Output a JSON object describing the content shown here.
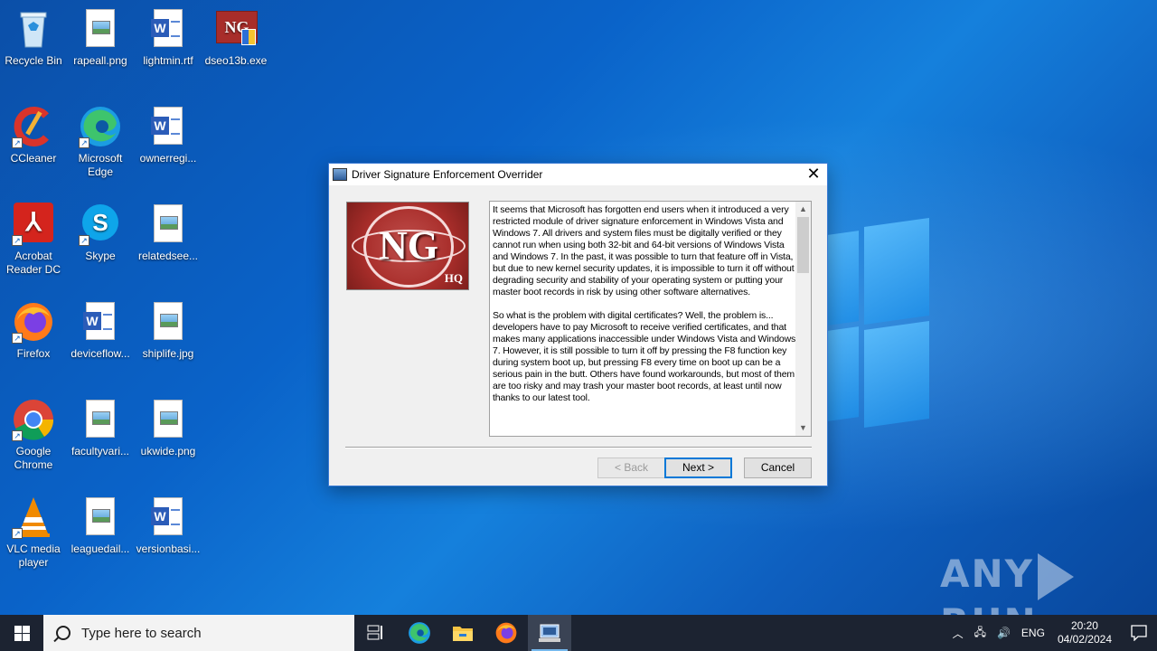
{
  "desktop": {
    "icons": [
      {
        "label": "Recycle Bin"
      },
      {
        "label": "rapeall.png"
      },
      {
        "label": "lightmin.rtf"
      },
      {
        "label": "dseo13b.exe"
      },
      {
        "label": "CCleaner"
      },
      {
        "label": "Microsoft Edge"
      },
      {
        "label": "ownerregi..."
      },
      {
        "label": "Acrobat Reader DC"
      },
      {
        "label": "Skype"
      },
      {
        "label": "relatedsee..."
      },
      {
        "label": "Firefox"
      },
      {
        "label": "deviceflow..."
      },
      {
        "label": "shiplife.jpg"
      },
      {
        "label": "Google Chrome"
      },
      {
        "label": "facultyvari..."
      },
      {
        "label": "ukwide.png"
      },
      {
        "label": "VLC media player"
      },
      {
        "label": "leaguedail..."
      },
      {
        "label": "versionbasi..."
      }
    ]
  },
  "dialog": {
    "title": "Driver Signature Enforcement Overrider",
    "logo": {
      "text": "NG",
      "sub": "HQ"
    },
    "paragraphs": [
      "It seems that Microsoft has forgotten end users when it introduced a very restricted module of driver signature enforcement in Windows Vista and Windows 7. All drivers and system files must be digitally verified or they cannot run when using both 32-bit and 64-bit versions of Windows Vista and Windows 7. In the past, it was possible to turn that feature off in Vista, but due to new kernel security updates, it is impossible to turn it off without degrading security and stability of your operating system or putting your master boot records in risk by using other software alternatives.",
      "So what is the problem with digital certificates? Well, the problem is... developers have to pay Microsoft to receive verified certificates, and that makes many applications inaccessible under Windows Vista and Windows 7. However, it is still possible to turn it off by pressing the F8 function key during system boot up, but pressing F8 every time on boot up can be a serious pain in the butt. Others have found workarounds, but most of them are too risky and may trash your master boot records, at least until now thanks to our latest tool."
    ],
    "buttons": {
      "back": "< Back",
      "next": "Next >",
      "cancel": "Cancel"
    }
  },
  "watermark": {
    "left": "ANY",
    "right": "RUN"
  },
  "taskbar": {
    "search_placeholder": "Type here to search",
    "apps": [
      "task-view",
      "microsoft-edge",
      "file-explorer",
      "firefox",
      "driver-signature-enforcement-overrider"
    ],
    "tray": {
      "language": "ENG",
      "time": "20:20",
      "date": "04/02/2024"
    }
  },
  "colors": {
    "accent": "#0078d7",
    "taskbar": "#1c2331",
    "desktop": "#0a63c9"
  }
}
